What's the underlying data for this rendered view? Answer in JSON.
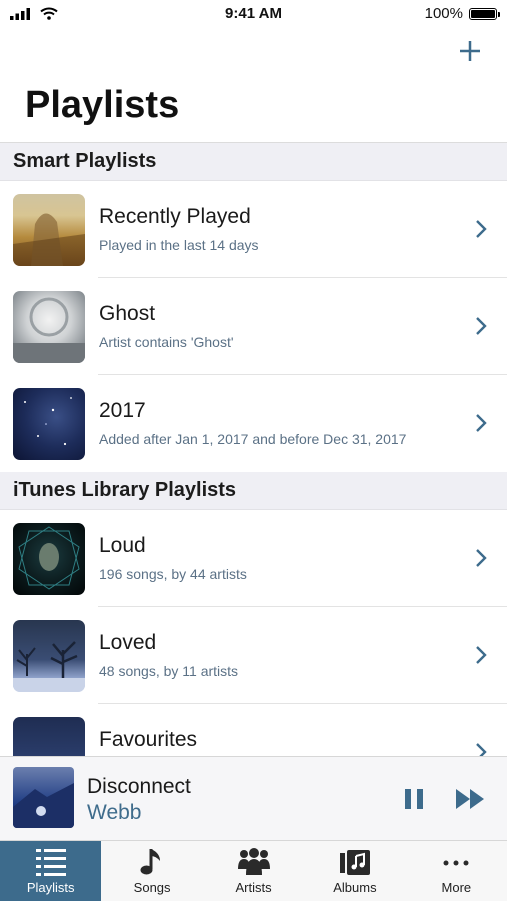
{
  "status_bar": {
    "time": "9:41 AM",
    "battery": "100%"
  },
  "header": {
    "title": "Playlists",
    "add_icon": "plus-icon"
  },
  "sections": [
    {
      "title": "Smart Playlists",
      "rows": [
        {
          "title": "Recently Played",
          "subtitle": "Played in the last 14 days"
        },
        {
          "title": "Ghost",
          "subtitle": "Artist contains 'Ghost'"
        },
        {
          "title": "2017",
          "subtitle": "Added after Jan 1, 2017 and before Dec 31, 2017"
        }
      ]
    },
    {
      "title": "iTunes Library Playlists",
      "rows": [
        {
          "title": "Loud",
          "subtitle": "196 songs, by 44 artists"
        },
        {
          "title": "Loved",
          "subtitle": "48 songs, by 11 artists"
        },
        {
          "title": "Favourites",
          "subtitle": ""
        }
      ]
    }
  ],
  "now_playing": {
    "title": "Disconnect",
    "artist": "Webb",
    "artist_color": "#3f6c8c"
  },
  "tabs": [
    {
      "label": "Playlists",
      "icon": "playlists-icon",
      "active": true
    },
    {
      "label": "Songs",
      "icon": "music-note-icon",
      "active": false
    },
    {
      "label": "Artists",
      "icon": "artists-icon",
      "active": false
    },
    {
      "label": "Albums",
      "icon": "albums-icon",
      "active": false
    },
    {
      "label": "More",
      "icon": "more-icon",
      "active": false
    }
  ],
  "colors": {
    "accent": "#3d6b8c",
    "subtitle": "#5b7186",
    "section_bg": "#efeff4"
  }
}
